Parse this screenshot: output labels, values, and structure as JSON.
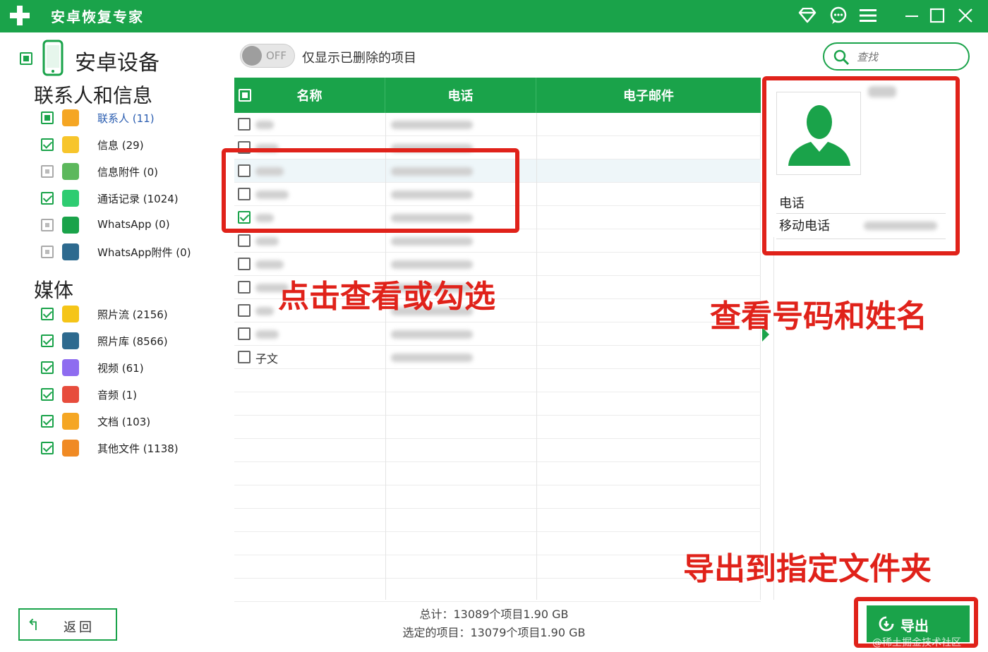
{
  "app": {
    "title": "安卓恢复专家"
  },
  "sidebar": {
    "device_title": "安卓设备",
    "sections": [
      {
        "title": "联系人和信息",
        "items": [
          {
            "label": "联系人 (11)",
            "icon": "contacts-icon",
            "color": "#f5a623",
            "state": "partial",
            "active": true
          },
          {
            "label": "信息 (29)",
            "icon": "message-icon",
            "color": "#f7c52b",
            "state": "checked"
          },
          {
            "label": "信息附件 (0)",
            "icon": "attachment-icon",
            "color": "#5cb85c",
            "state": "disabled"
          },
          {
            "label": "通话记录 (1024)",
            "icon": "phone-icon",
            "color": "#2ecc71",
            "state": "checked"
          },
          {
            "label": "WhatsApp (0)",
            "icon": "whatsapp-icon",
            "color": "#1aa34a",
            "state": "disabled"
          },
          {
            "label": "WhatsApp附件 (0)",
            "icon": "whatsapp-attachment-icon",
            "color": "#2d6a8f",
            "state": "disabled"
          }
        ]
      },
      {
        "title": "媒体",
        "items": [
          {
            "label": "照片流 (2156)",
            "icon": "star-icon",
            "color": "#f5c518",
            "state": "checked"
          },
          {
            "label": "照片库 (8566)",
            "icon": "photo-library-icon",
            "color": "#2d6a8f",
            "state": "checked"
          },
          {
            "label": "视频 (61)",
            "icon": "video-icon",
            "color": "#8e6cf0",
            "state": "checked"
          },
          {
            "label": "音频 (1)",
            "icon": "audio-icon",
            "color": "#e74c3c",
            "state": "checked"
          },
          {
            "label": "文档 (103)",
            "icon": "folder-icon",
            "color": "#f5a623",
            "state": "checked"
          },
          {
            "label": "其他文件 (1138)",
            "icon": "other-file-icon",
            "color": "#f08a24",
            "state": "checked"
          }
        ]
      }
    ]
  },
  "toolbar": {
    "toggle_text": "OFF",
    "toggle_label": "仅显示已删除的项目",
    "search_placeholder": "查找"
  },
  "table": {
    "columns": [
      "名称",
      "电话",
      "电子邮件"
    ],
    "rows": [
      {
        "name": "",
        "checked": false
      },
      {
        "name": "",
        "checked": false
      },
      {
        "name": "",
        "checked": false,
        "highlight": true
      },
      {
        "name": "",
        "checked": false
      },
      {
        "name": "",
        "checked": true
      },
      {
        "name": "",
        "checked": false
      },
      {
        "name": "",
        "checked": false
      },
      {
        "name": "",
        "checked": false
      },
      {
        "name": "",
        "checked": false
      },
      {
        "name": "",
        "checked": false
      },
      {
        "name": "子文",
        "checked": false
      }
    ]
  },
  "detail": {
    "section_label": "电话",
    "field_label": "移动电话"
  },
  "annotations": {
    "click_hint": "点击查看或勾选",
    "view_hint": "查看号码和姓名",
    "export_hint": "导出到指定文件夹"
  },
  "footer": {
    "back_label": "返回",
    "total": "总计：13089个项目1.90 GB",
    "selected": "选定的项目：13079个项目1.90 GB",
    "export_label": "导出",
    "watermark": "@稀土掘金技术社区"
  },
  "colors": {
    "brand": "#1aa34a",
    "annotation": "#e0221a"
  }
}
